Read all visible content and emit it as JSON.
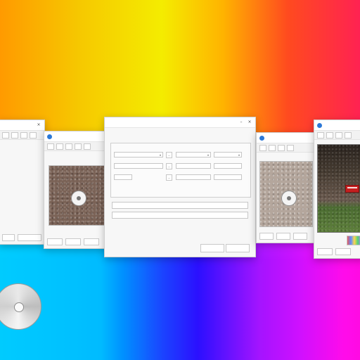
{
  "windows": {
    "left_window": {
      "title": "",
      "footer_buttons": [
        "",
        ""
      ]
    },
    "left_mid_window": {
      "title": "",
      "footer_buttons": [
        "",
        "",
        ""
      ]
    },
    "dialog": {
      "title": "",
      "section_label": "",
      "rows": [
        {
          "a": "",
          "b": "",
          "c": ""
        },
        {
          "a": "",
          "b": "",
          "c": ""
        },
        {
          "a": "",
          "b": "",
          "c": ""
        }
      ],
      "wide_fields": [
        "",
        ""
      ],
      "footer_buttons": [
        "",
        ""
      ]
    },
    "right_mid_window": {
      "title": "",
      "footer_buttons": [
        "",
        "",
        ""
      ]
    },
    "right_window": {
      "title": "",
      "footer_buttons": [
        "",
        ""
      ]
    }
  },
  "icons": {
    "app_icon": "app-icon",
    "close": "close-icon",
    "minimize": "minimize-icon",
    "maximize": "maximize-icon",
    "chevron": "chevron-down-icon"
  }
}
